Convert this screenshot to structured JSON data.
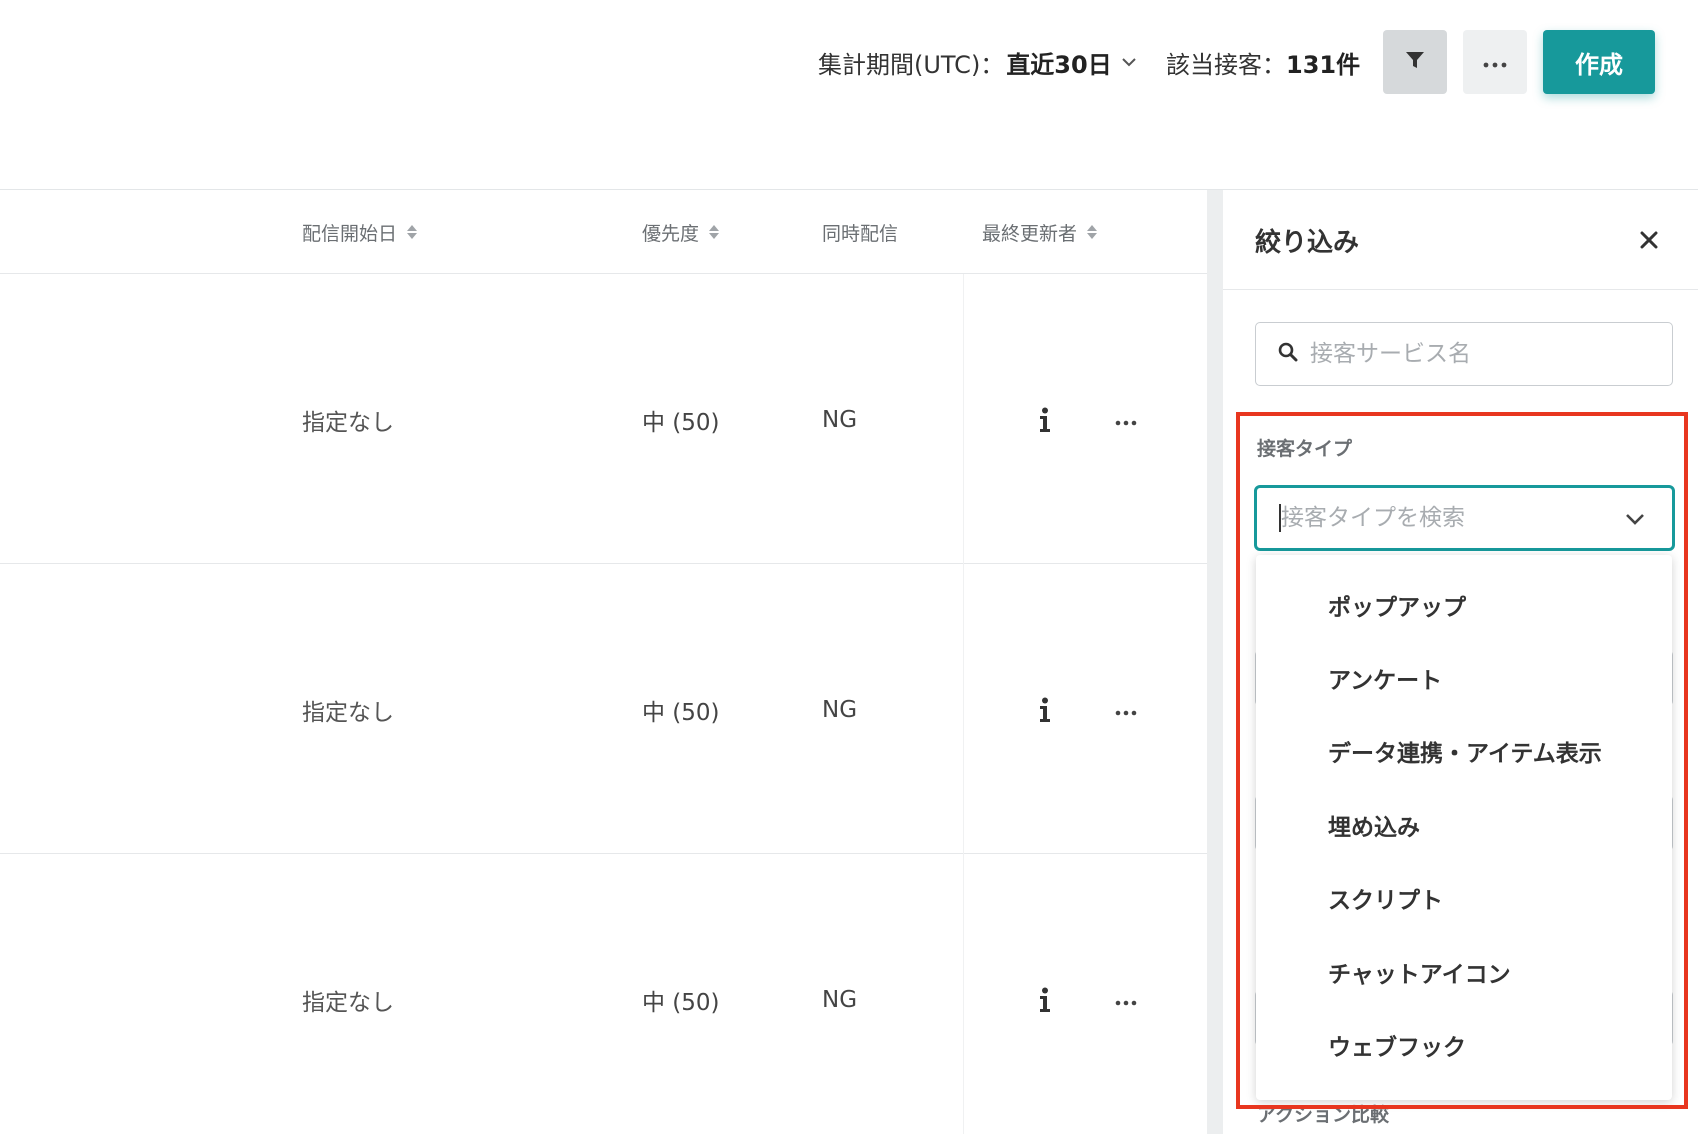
{
  "header": {
    "period_label": "集計期間(UTC)：",
    "period_value": "直近30日",
    "count_label": "該当接客：",
    "count_value": "131件",
    "more_label": "···",
    "create_label": "作成"
  },
  "table": {
    "columns": [
      {
        "label": "配信開始日",
        "sortable": true
      },
      {
        "label": "優先度",
        "sortable": true
      },
      {
        "label": "同時配信",
        "sortable": false
      },
      {
        "label": "最終更新者",
        "sortable": true
      }
    ],
    "rows": [
      {
        "start_date": "指定なし",
        "priority": "中 (50)",
        "simultaneous": "NG",
        "more": "···"
      },
      {
        "start_date": "指定なし",
        "priority": "中 (50)",
        "simultaneous": "NG",
        "more": "···"
      },
      {
        "start_date": "指定なし",
        "priority": "中 (50)",
        "simultaneous": "NG",
        "more": "···"
      }
    ]
  },
  "filter_panel": {
    "title": "絞り込み",
    "search_placeholder": "接客サービス名",
    "type_label": "接客タイプ",
    "type_placeholder": "接客タイプを検索",
    "type_options": [
      "ポップアップ",
      "アンケート",
      "データ連携・アイテム表示",
      "埋め込み",
      "スクリプト",
      "チャットアイコン",
      "ウェブフック"
    ],
    "next_section_label": "アクション比較"
  },
  "colors": {
    "accent": "#17999b",
    "highlight": "#e8361f",
    "filter_button_bg": "#d6d9db"
  },
  "icons": {
    "filter": "funnel-icon",
    "info": "info-icon",
    "close": "close-icon",
    "search": "search-icon",
    "chevron": "chevron-down-icon"
  }
}
